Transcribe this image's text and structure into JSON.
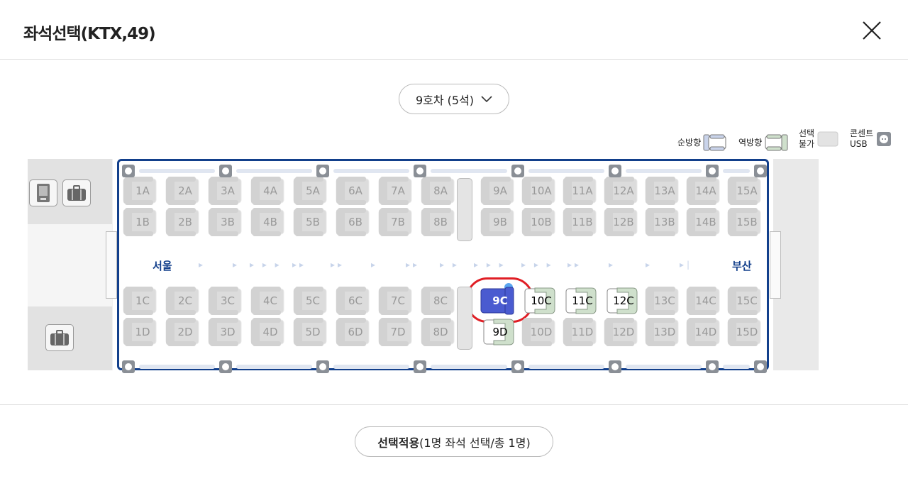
{
  "header": {
    "title": "좌석선택(KTX,49)"
  },
  "car_selector": {
    "label": "9호차 (5석)"
  },
  "legend": [
    {
      "label": "순방향",
      "icon": "forward-seat-icon"
    },
    {
      "label": "역방향",
      "icon": "reverse-seat-icon"
    },
    {
      "label": "선택\n불가",
      "icon": "unavailable-seat-icon"
    },
    {
      "label": "콘센트\nUSB",
      "icon": "outlet-icon"
    }
  ],
  "route": {
    "from": "서울",
    "to": "부산"
  },
  "seats": {
    "row_a": [
      "1A",
      "2A",
      "3A",
      "4A",
      "5A",
      "6A",
      "7A",
      "8A",
      "9A",
      "10A",
      "11A",
      "12A",
      "13A",
      "14A",
      "15A"
    ],
    "row_b": [
      "1B",
      "2B",
      "3B",
      "4B",
      "5B",
      "6B",
      "7B",
      "8B",
      "9B",
      "10B",
      "11B",
      "12B",
      "13B",
      "14B",
      "15B"
    ],
    "row_c": [
      "1C",
      "2C",
      "3C",
      "4C",
      "5C",
      "6C",
      "7C",
      "8C",
      "9C",
      "10C",
      "11C",
      "12C",
      "13C",
      "14C",
      "15C"
    ],
    "row_d": [
      "1D",
      "2D",
      "3D",
      "4D",
      "5D",
      "6D",
      "7D",
      "8D",
      "9D",
      "10D",
      "11D",
      "12D",
      "13D",
      "14D",
      "15D"
    ],
    "available": [
      "9D",
      "10C",
      "11C",
      "12C"
    ],
    "selected": [
      "9C"
    ]
  },
  "colors": {
    "car_border": "#123f8b",
    "selected": "#4a5bd0",
    "available_back": "#cfe0cc",
    "unavailable": "#dcdcdc",
    "circle": "#e01e25"
  },
  "footer": {
    "apply_bold": "선택적용",
    "apply_rest": "(1명 좌석 선택/총 1명)"
  }
}
